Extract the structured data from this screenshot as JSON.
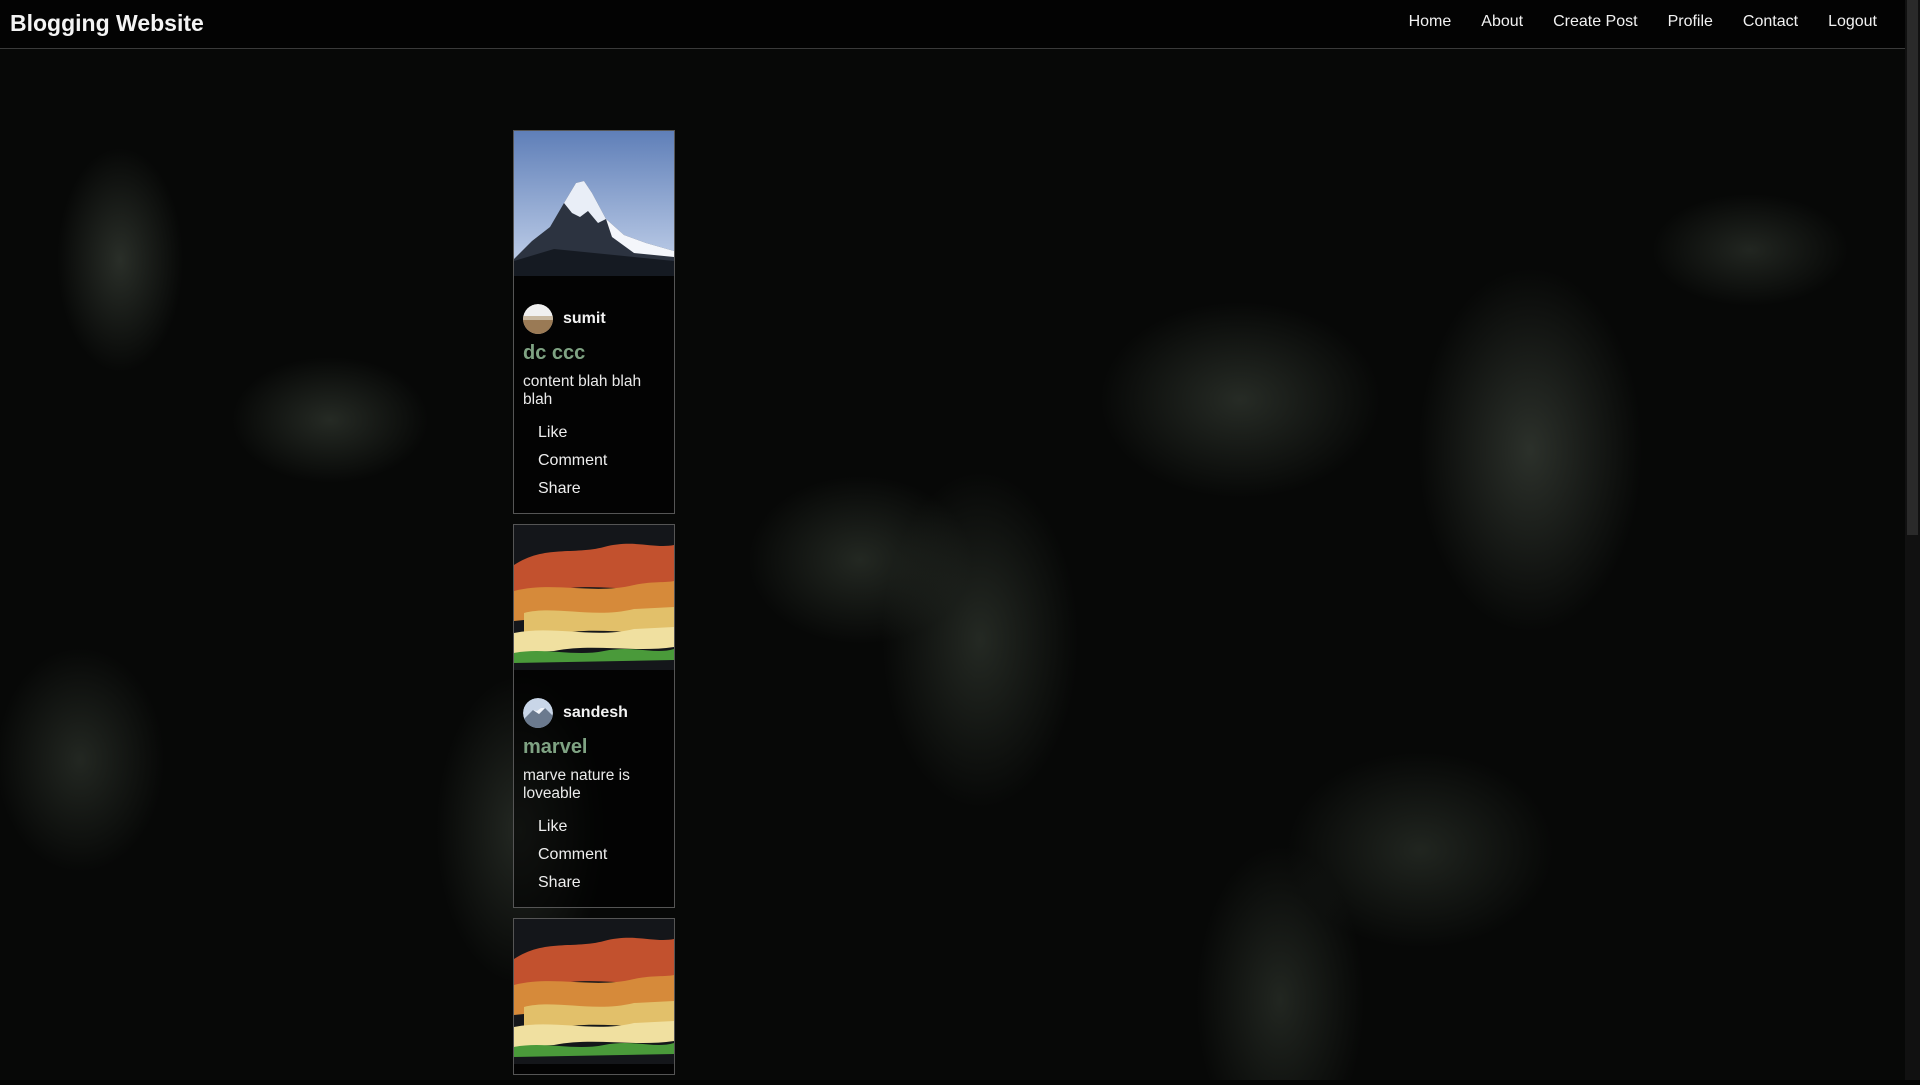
{
  "header": {
    "brand": "Blogging Website"
  },
  "nav": {
    "items": [
      "Home",
      "About",
      "Create Post",
      "Profile",
      "Contact",
      "Logout"
    ]
  },
  "posts": [
    {
      "author": "sumit",
      "title": "dc ccc",
      "content": "content blah blah blah",
      "actions": [
        "Like",
        "Comment",
        "Share"
      ]
    },
    {
      "author": "sandesh",
      "title": "marvel",
      "content": "marve nature is loveable",
      "actions": [
        "Like",
        "Comment",
        "Share"
      ]
    }
  ],
  "colors": {
    "title": "#7fa383",
    "header_bg": "#000000",
    "text": "#f2f2f2"
  }
}
